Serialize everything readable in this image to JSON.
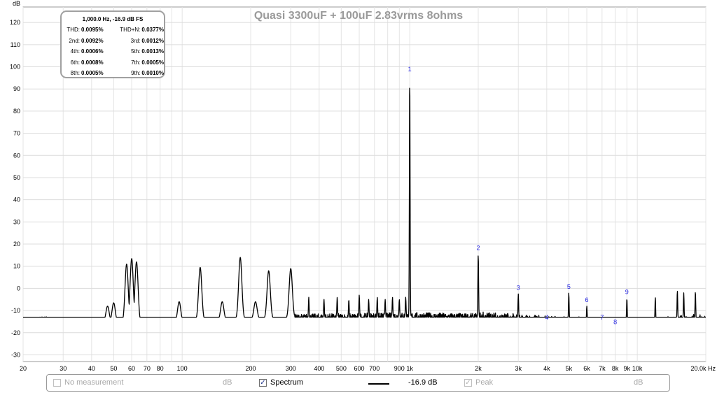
{
  "chart_data": {
    "type": "line",
    "title": "Quasi 3300uF + 100uF 2.83vrms 8ohms",
    "ylabel_unit": "dB",
    "xlabel_unit": "Hz",
    "x_scale": "log",
    "xlim": [
      20,
      20000
    ],
    "ylim": [
      -33,
      127
    ],
    "grid": true,
    "y_ticks": [
      120,
      110,
      100,
      90,
      80,
      70,
      60,
      50,
      40,
      30,
      20,
      10,
      0,
      -10,
      -20,
      -30
    ],
    "x_ticks": [
      {
        "v": 20,
        "label": "20"
      },
      {
        "v": 30,
        "label": "30"
      },
      {
        "v": 40,
        "label": "40"
      },
      {
        "v": 50,
        "label": "50"
      },
      {
        "v": 60,
        "label": "60"
      },
      {
        "v": 70,
        "label": "70"
      },
      {
        "v": 80,
        "label": "80"
      },
      {
        "v": 100,
        "label": "100"
      },
      {
        "v": 200,
        "label": "200"
      },
      {
        "v": 300,
        "label": "300"
      },
      {
        "v": 400,
        "label": "400"
      },
      {
        "v": 500,
        "label": "500"
      },
      {
        "v": 600,
        "label": "600"
      },
      {
        "v": 700,
        "label": "700"
      },
      {
        "v": 900,
        "label": "900"
      },
      {
        "v": 1000,
        "label": "1k"
      },
      {
        "v": 2000,
        "label": "2k"
      },
      {
        "v": 3000,
        "label": "3k"
      },
      {
        "v": 4000,
        "label": "4k"
      },
      {
        "v": 5000,
        "label": "5k"
      },
      {
        "v": 6000,
        "label": "6k"
      },
      {
        "v": 7000,
        "label": "7k"
      },
      {
        "v": 8000,
        "label": "8k"
      },
      {
        "v": 9000,
        "label": "9k"
      },
      {
        "v": 10000,
        "label": "10k"
      },
      {
        "v": 20000,
        "label": "20.0k Hz"
      }
    ],
    "harmonic_markers": [
      {
        "label": "1",
        "x": 1000,
        "y": 96
      },
      {
        "label": "2",
        "x": 2000,
        "y": 15.5
      },
      {
        "label": "3",
        "x": 3000,
        "y": -2.5
      },
      {
        "label": "4",
        "x": 4000,
        "y": -16
      },
      {
        "label": "5",
        "x": 5000,
        "y": -2
      },
      {
        "label": "6",
        "x": 6000,
        "y": -8
      },
      {
        "label": "7",
        "x": 7000,
        "y": -16
      },
      {
        "label": "8",
        "x": 8000,
        "y": -18
      },
      {
        "label": "9",
        "x": 9000,
        "y": -4.5
      }
    ],
    "series": [
      {
        "name": "Spectrum",
        "color": "#000000",
        "noise_floor": [
          [
            20,
            -14
          ],
          [
            25,
            -13.5
          ],
          [
            30,
            -15
          ],
          [
            40,
            -14.5
          ],
          [
            60,
            -16
          ],
          [
            80,
            -17
          ],
          [
            100,
            -15
          ],
          [
            200,
            -14
          ],
          [
            500,
            -13.5
          ],
          [
            1000,
            -13
          ],
          [
            2000,
            -13.5
          ],
          [
            4000,
            -15.5
          ],
          [
            8000,
            -16.5
          ],
          [
            10000,
            -17
          ],
          [
            20000,
            -14.5
          ]
        ],
        "peaks": [
          [
            47,
            -8
          ],
          [
            50,
            -6.5
          ],
          [
            57,
            11
          ],
          [
            60,
            13.5
          ],
          [
            63,
            12
          ],
          [
            97,
            -6
          ],
          [
            120,
            9.5
          ],
          [
            150,
            -6
          ],
          [
            180,
            14
          ],
          [
            210,
            -6
          ],
          [
            240,
            8
          ],
          [
            300,
            9
          ],
          [
            360,
            -4
          ],
          [
            420,
            -5
          ],
          [
            480,
            -4
          ],
          [
            540,
            -5
          ],
          [
            600,
            -3
          ],
          [
            660,
            -5
          ],
          [
            720,
            -4
          ],
          [
            780,
            -5
          ],
          [
            840,
            -4
          ],
          [
            900,
            -5
          ],
          [
            960,
            -4
          ],
          [
            1000,
            96
          ],
          [
            2000,
            15.5
          ],
          [
            3000,
            -2.5
          ],
          [
            4000,
            -16
          ],
          [
            5000,
            -2
          ],
          [
            6000,
            -8
          ],
          [
            7000,
            -16
          ],
          [
            8000,
            -18
          ],
          [
            9000,
            -4.5
          ],
          [
            12000,
            -4
          ],
          [
            15000,
            -1
          ],
          [
            16000,
            -2
          ],
          [
            18000,
            -1.5
          ]
        ]
      }
    ]
  },
  "info_box": {
    "header": "1,000.0 Hz, -16.9 dB FS",
    "rows": [
      {
        "l1": "THD:",
        "v1": "0.0095%",
        "l2": "THD+N:",
        "v2": "0.0377%"
      },
      {
        "l1": "2nd:",
        "v1": "0.0092%",
        "l2": "3rd:",
        "v2": "0.0012%"
      },
      {
        "l1": "4th:",
        "v1": "0.0006%",
        "l2": "5th:",
        "v2": "0.0013%"
      },
      {
        "l1": "6th:",
        "v1": "0.0008%",
        "l2": "7th:",
        "v2": "0.0005%"
      },
      {
        "l1": "8th:",
        "v1": "0.0005%",
        "l2": "9th:",
        "v2": "0.0010%"
      }
    ]
  },
  "legend": {
    "no_measurement": "No measurement",
    "no_measurement_unit": "dB",
    "spectrum": "Spectrum",
    "spectrum_value": "-16.9 dB",
    "peak": "Peak",
    "peak_unit": "dB",
    "check_mark": "✓"
  }
}
